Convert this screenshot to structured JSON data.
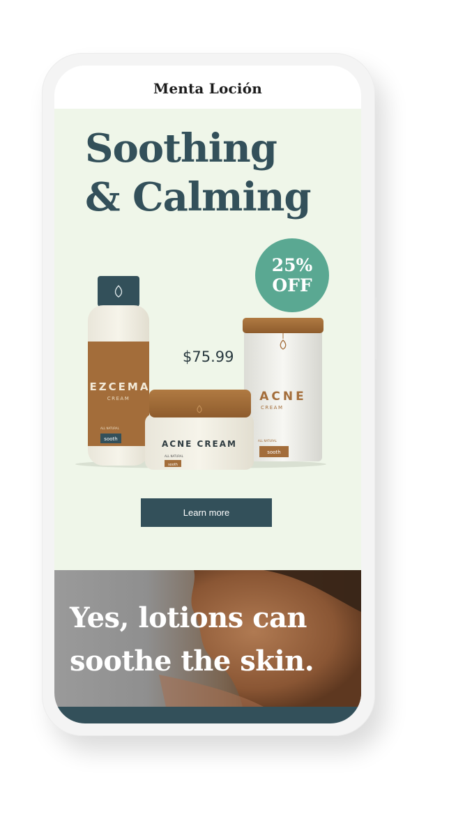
{
  "brand": "Menta Loción",
  "hero": {
    "headline_line1": "Soothing",
    "headline_line2": "& Calming",
    "badge_line1": "25%",
    "badge_line2": "OFF",
    "price": "$75.99",
    "cta_label": "Learn more"
  },
  "products": {
    "bottle": {
      "name": "EZCEMA",
      "sub": "CREAM",
      "small": "ALL NATURAL",
      "tag": "sooth"
    },
    "jar": {
      "name": "ACNE CREAM",
      "small": "ALL NATURAL",
      "tag": "sooth"
    },
    "tube": {
      "name": "ACNE",
      "sub": "CREAM",
      "small": "ALL NATURAL",
      "tag": "sooth"
    }
  },
  "story": {
    "line1": "Yes, lotions can",
    "line2": "soothe the skin."
  },
  "colors": {
    "accent": "#33505a",
    "hero_bg": "#eff6e9",
    "badge": "#5aa892",
    "product_brown": "#a36d3a"
  }
}
